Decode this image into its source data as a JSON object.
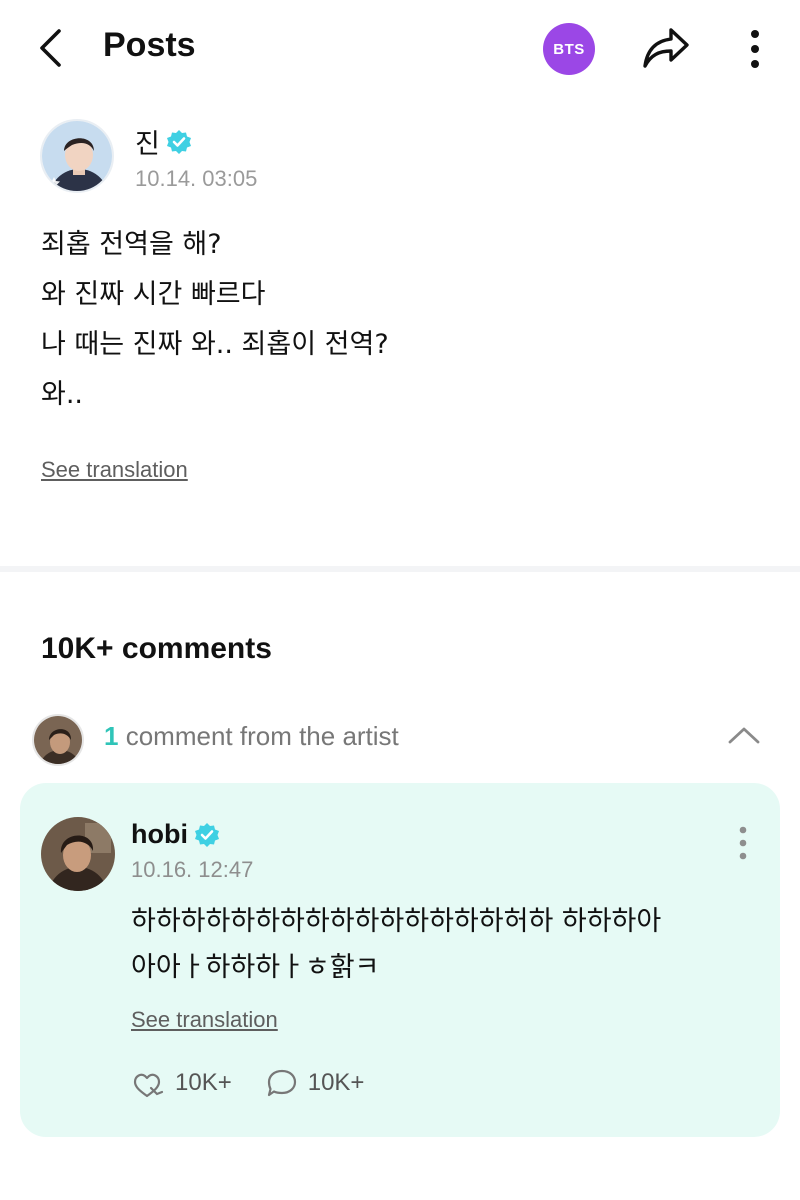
{
  "header": {
    "title": "Posts",
    "community_badge": "BTS",
    "colors": {
      "badge": "#9b47e6"
    }
  },
  "post": {
    "author": "진",
    "verified": true,
    "timestamp": "10.14. 03:05",
    "lines": [
      "죄홉 전역을 해?",
      "와 진짜 시간 빠르다",
      "나 때는 진짜 와.. 죄홉이 전역?",
      "와.."
    ],
    "see_translation": "See translation"
  },
  "comments": {
    "count_label": "10K+ comments",
    "artist_bar": {
      "count": "1",
      "label": "comment from the artist"
    },
    "artist_comment": {
      "author": "hobi",
      "verified": true,
      "timestamp": "10.16. 12:47",
      "lines": [
        "하하하하하하하하하하하하하하하허하 하하하아",
        "아아ㅏ하하하ㅏㅎ핡ㅋ"
      ],
      "see_translation": "See translation",
      "likes": "10K+",
      "replies": "10K+"
    }
  },
  "colors": {
    "accent_teal": "#2fc4b8",
    "verified": "#3fd0e3",
    "card_bg": "#e6faf5"
  }
}
